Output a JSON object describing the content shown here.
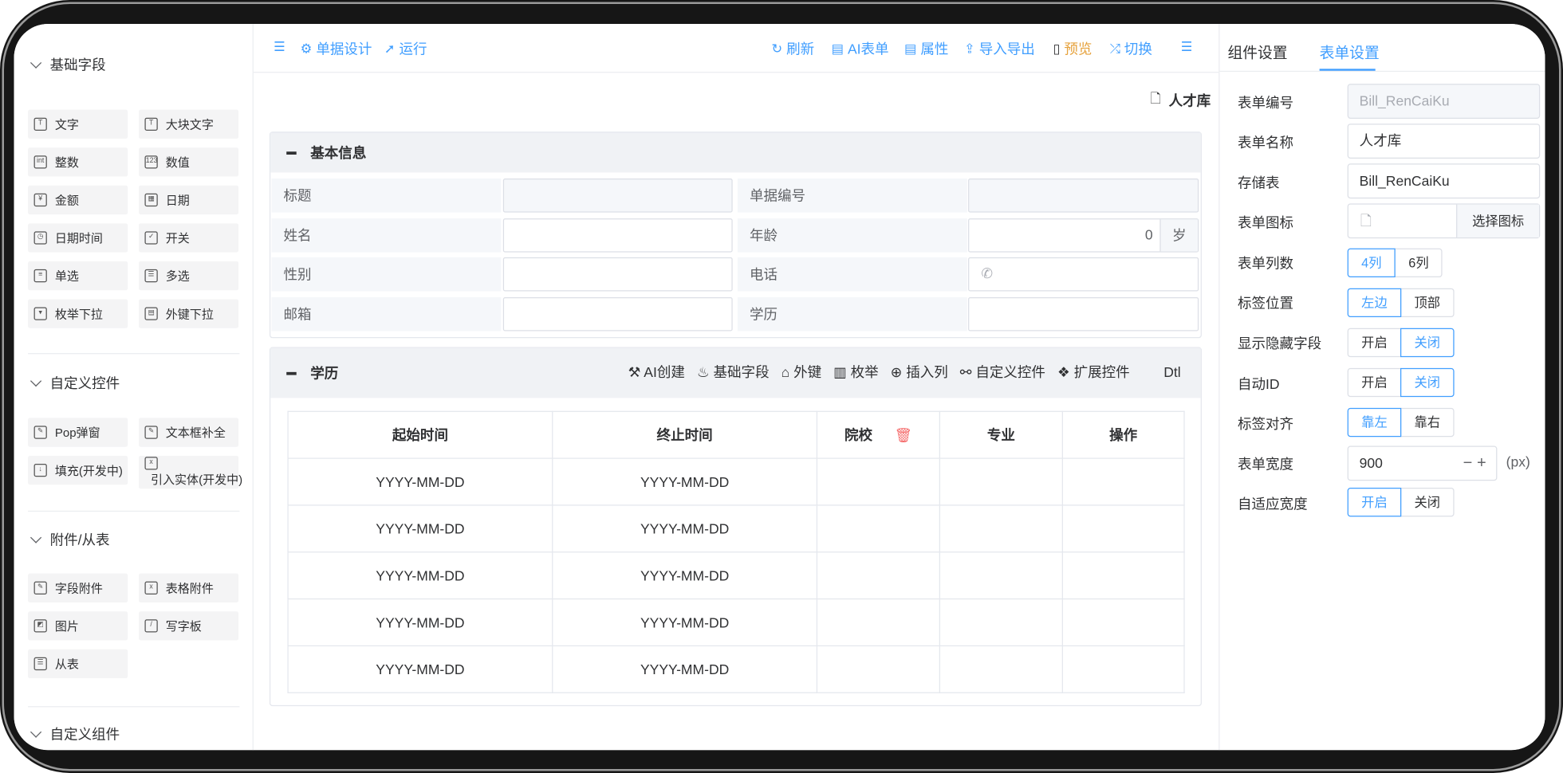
{
  "palette": {
    "groups": [
      {
        "title": "基础字段"
      },
      {
        "title": "自定义控件"
      },
      {
        "title": "附件/从表"
      },
      {
        "title": "自定义组件"
      }
    ],
    "basic": [
      "文字",
      "大块文字",
      "整数",
      "数值",
      "金额",
      "日期",
      "日期时间",
      "开关",
      "单选",
      "多选",
      "枚举下拉",
      "外键下拉"
    ],
    "custom": [
      "Pop弹窗",
      "文本框补全",
      "填充(开发中)",
      "引入实体(开发中)"
    ],
    "attach": [
      "字段附件",
      "表格附件",
      "图片",
      "写字板",
      "从表"
    ]
  },
  "toolbar": {
    "design": "单据设计",
    "run": "运行",
    "refresh": "刷新",
    "ai_form": "AI表单",
    "attrs": "属性",
    "import_export": "导入导出",
    "preview": "预览",
    "switch": "切换"
  },
  "form": {
    "title": "人才库",
    "basic_section": "基本信息",
    "fields": {
      "title": "标题",
      "bill_no": "单据编号",
      "name": "姓名",
      "age": "年龄",
      "age_value": "0",
      "age_unit": "岁",
      "gender": "性别",
      "phone": "电话",
      "email": "邮箱",
      "education": "学历"
    },
    "dtl": {
      "title": "学历",
      "tools": [
        "AI创建",
        "基础字段",
        "外键",
        "枚举",
        "插入列",
        "自定义控件",
        "扩展控件"
      ],
      "tag": "Dtl",
      "columns": [
        "起始时间",
        "终止时间",
        "院校",
        "专业",
        "操作"
      ],
      "rows": [
        [
          "YYYY-MM-DD",
          "YYYY-MM-DD"
        ],
        [
          "YYYY-MM-DD",
          "YYYY-MM-DD"
        ],
        [
          "YYYY-MM-DD",
          "YYYY-MM-DD"
        ],
        [
          "YYYY-MM-DD",
          "YYYY-MM-DD"
        ],
        [
          "YYYY-MM-DD",
          "YYYY-MM-DD"
        ]
      ]
    }
  },
  "props": {
    "tabs": [
      "组件设置",
      "表单设置"
    ],
    "active_tab": "表单设置",
    "bill_no_label": "表单编号",
    "bill_no_value": "Bill_RenCaiKu",
    "name_label": "表单名称",
    "name_value": "人才库",
    "table_label": "存储表",
    "table_value": "Bill_RenCaiKu",
    "icon_label": "表单图标",
    "icon_button": "选择图标",
    "cols_label": "表单列数",
    "cols_options": [
      "4列",
      "6列"
    ],
    "labelpos_label": "标签位置",
    "labelpos_options": [
      "左边",
      "顶部"
    ],
    "hidden_label": "显示隐藏字段",
    "hidden_options": [
      "开启",
      "关闭"
    ],
    "autoid_label": "自动ID",
    "autoid_options": [
      "开启",
      "关闭"
    ],
    "align_label": "标签对齐",
    "align_options": [
      "靠左",
      "靠右"
    ],
    "width_label": "表单宽度",
    "width_value": "900",
    "width_unit": "(px)",
    "adaptive_label": "自适应宽度",
    "adaptive_options": [
      "开启",
      "关闭"
    ]
  },
  "colors": {
    "accent": "#409eff",
    "preview": "#e6a23c",
    "danger": "#f56c6c"
  }
}
